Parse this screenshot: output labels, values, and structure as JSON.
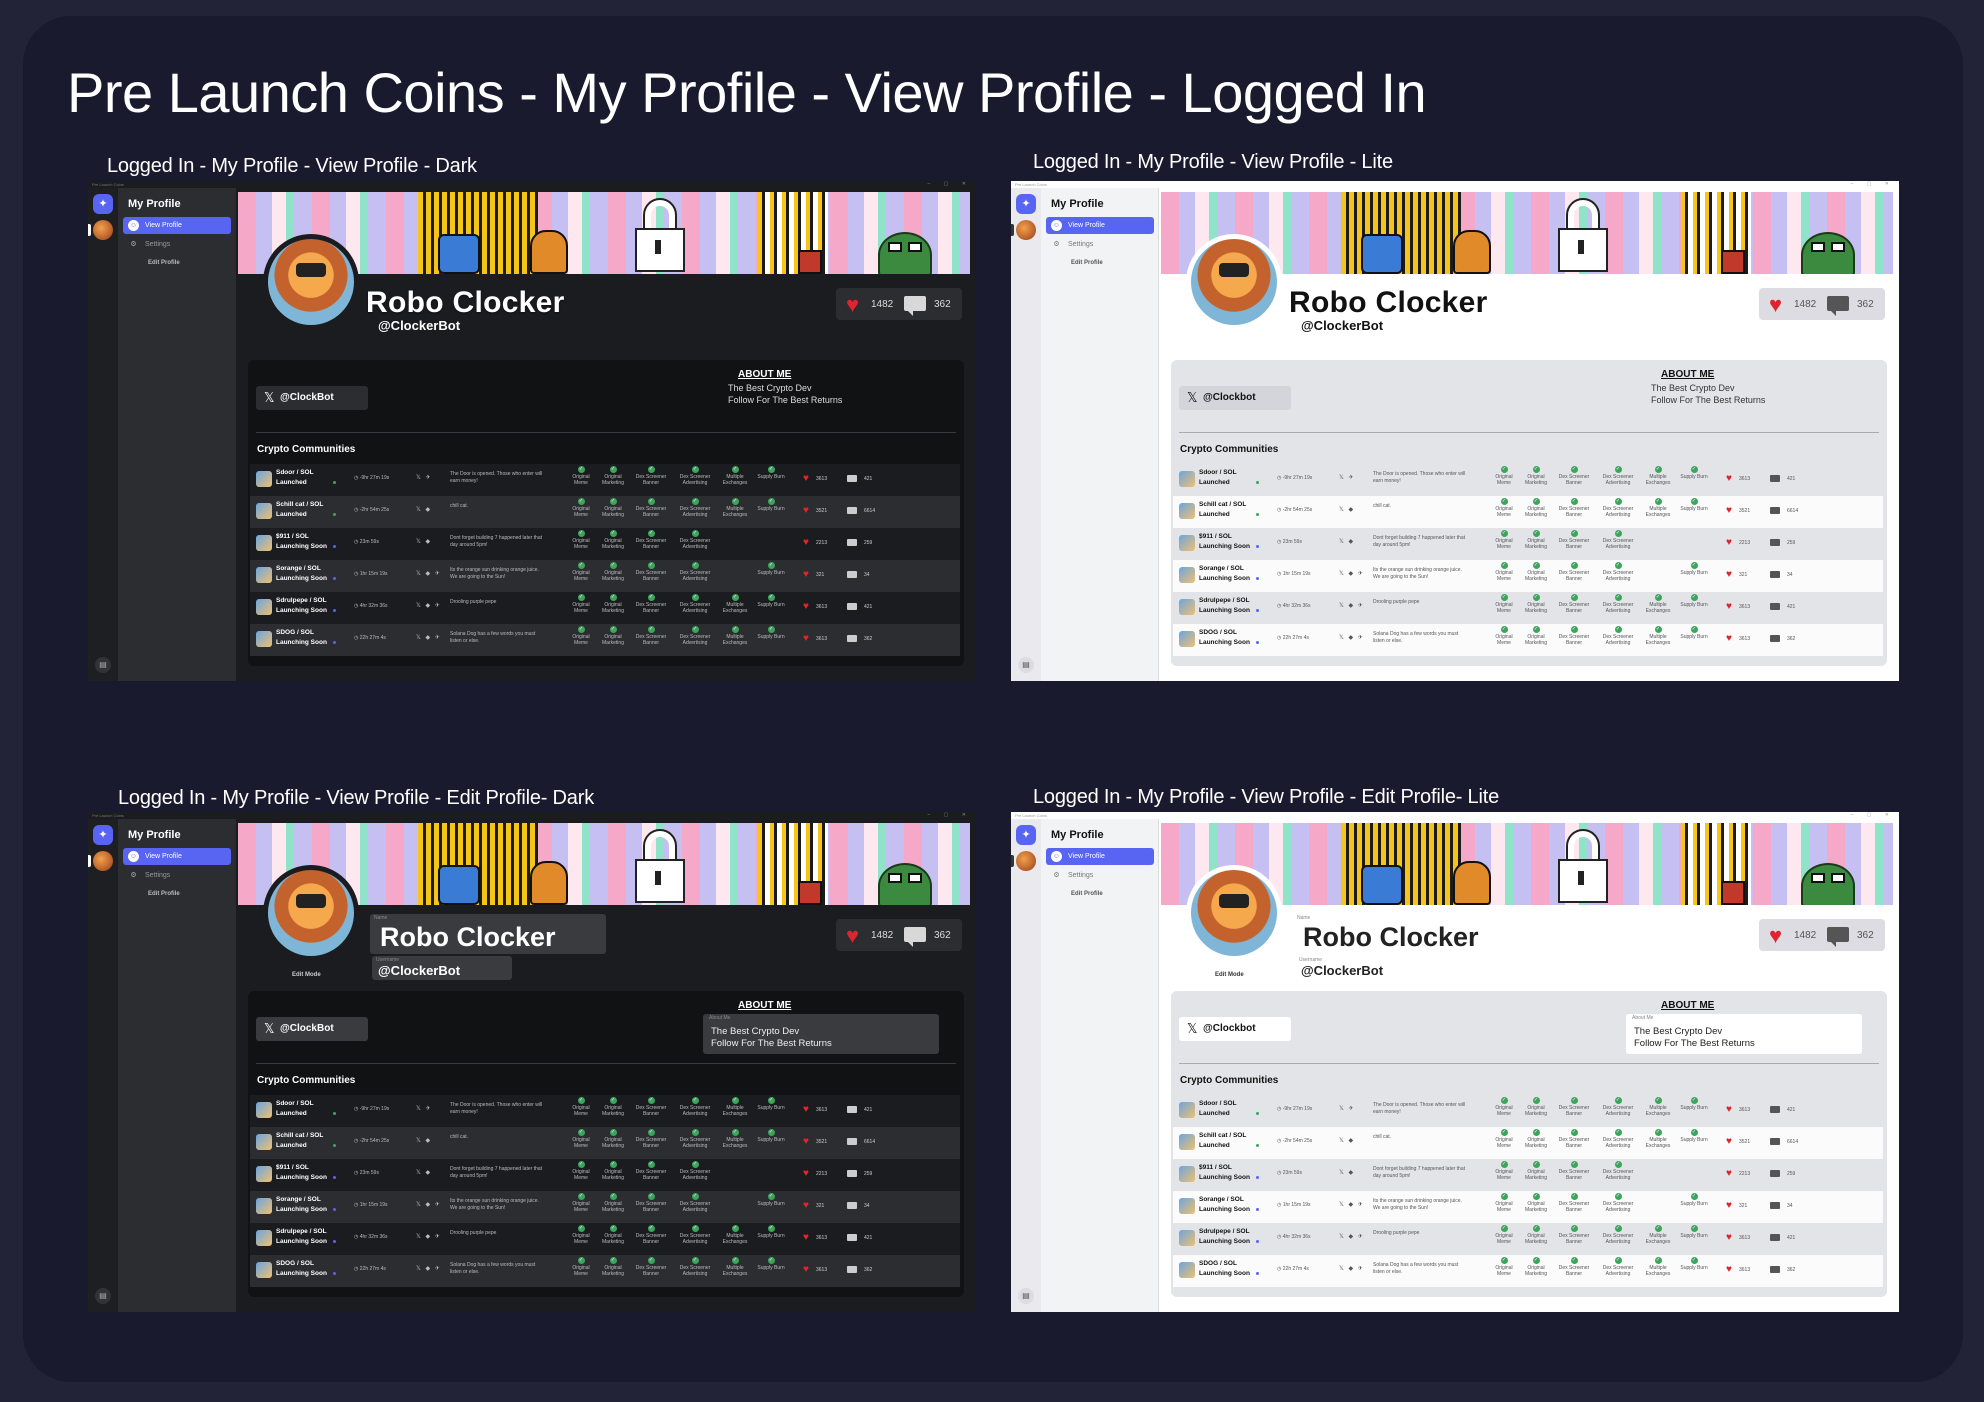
{
  "main_title": "Pre Launch Coins - My Profile - View Profile - Logged In",
  "app_name": "Pre Launch Coins",
  "window_controls": "– ▢ ✕",
  "nav": {
    "title": "My Profile",
    "view_profile": "View Profile",
    "settings": "Settings",
    "edit_profile": "Edit Profile"
  },
  "profile": {
    "name": "Robo Clocker",
    "handle": "@ClockerBot",
    "likes": "1482",
    "comments": "362",
    "about_title": "ABOUT ME",
    "about_text": "The Best Crypto Dev\nFollow For The Best Returns",
    "edit_mode": "Edit Mode",
    "name_label": "Name",
    "username_label": "Username",
    "about_label": "About Me",
    "communities_title": "Crypto Communities"
  },
  "panels": [
    {
      "id": "dark-view",
      "label": "Logged In - My Profile - View Profile - Dark",
      "theme": "dark",
      "editing": false,
      "x_handle": "@ClockBot"
    },
    {
      "id": "lite-view",
      "label": "Logged In - My Profile - View Profile - Lite",
      "theme": "lite",
      "editing": false,
      "x_handle": "@Clockbot"
    },
    {
      "id": "dark-edit",
      "label": "Logged In - My Profile - View Profile - Edit Profile- Dark",
      "theme": "dark",
      "editing": true,
      "x_handle": "@ClockBot"
    },
    {
      "id": "lite-edit",
      "label": "Logged In - My Profile - View Profile - Edit Profile- Lite",
      "theme": "lite",
      "editing": true,
      "x_handle": "@Clockbot"
    }
  ],
  "tag_labels": {
    "memes": "Original Meme",
    "marketing": "Original Marketing",
    "banner": "Dex Screener Banner",
    "advertising": "Dex Screener Advertising",
    "exchanges": "Multiple Exchanges",
    "burn": "Supply Burn"
  },
  "status_colors": {
    "Launched": "#3ba55c",
    "Launching Soon": "#5865f2"
  },
  "communities": [
    {
      "name": "Sdoor / SOL",
      "status": "Launched",
      "time": "-9hr 27m 19s",
      "social": "𝕏 ✈",
      "desc": "The Door is opened. Those who enter will earn money!",
      "tags": [
        "memes",
        "marketing",
        "banner",
        "advertising",
        "exchanges",
        "burn"
      ],
      "likes": "3613",
      "comments": "421"
    },
    {
      "name": "Schill cat / SOL",
      "status": "Launched",
      "time": "-2hr 54m 25s",
      "social": "𝕏 ◆",
      "desc": "chill cat.",
      "tags": [
        "memes",
        "marketing",
        "banner",
        "advertising",
        "exchanges",
        "burn"
      ],
      "likes": "3521",
      "comments": "6614"
    },
    {
      "name": "$911 / SOL",
      "status": "Launching Soon",
      "time": "23m 59s",
      "social": "𝕏 ◆",
      "desc": "Dont forget building 7 happened later that day around 5pm!",
      "tags": [
        "memes",
        "marketing",
        "banner",
        "advertising"
      ],
      "likes": "2213",
      "comments": "259"
    },
    {
      "name": "Sorange / SOL",
      "status": "Launching Soon",
      "time": "1hr 15m 19s",
      "social": "𝕏 ◆ ✈",
      "desc": "Its the orange sun drinking orange juice. We are going to the Sun!",
      "tags": [
        "memes",
        "marketing",
        "banner",
        "advertising",
        "burn"
      ],
      "likes": "321",
      "comments": "34"
    },
    {
      "name": "Sdrulpepe / SOL",
      "status": "Launching Soon",
      "time": "4hr 32m 36s",
      "social": "𝕏 ◆ ✈",
      "desc": "Drooling purple pepe",
      "tags": [
        "memes",
        "marketing",
        "banner",
        "advertising",
        "exchanges",
        "burn"
      ],
      "likes": "3613",
      "comments": "421"
    },
    {
      "name": "SDOG / SOL",
      "status": "Launching Soon",
      "time": "22h 27m 4s",
      "social": "𝕏 ◆ ✈",
      "desc": "Solana Dog has a few words you must listen or else.",
      "tags": [
        "memes",
        "marketing",
        "banner",
        "advertising",
        "exchanges",
        "burn"
      ],
      "likes": "3613",
      "comments": "362"
    }
  ]
}
